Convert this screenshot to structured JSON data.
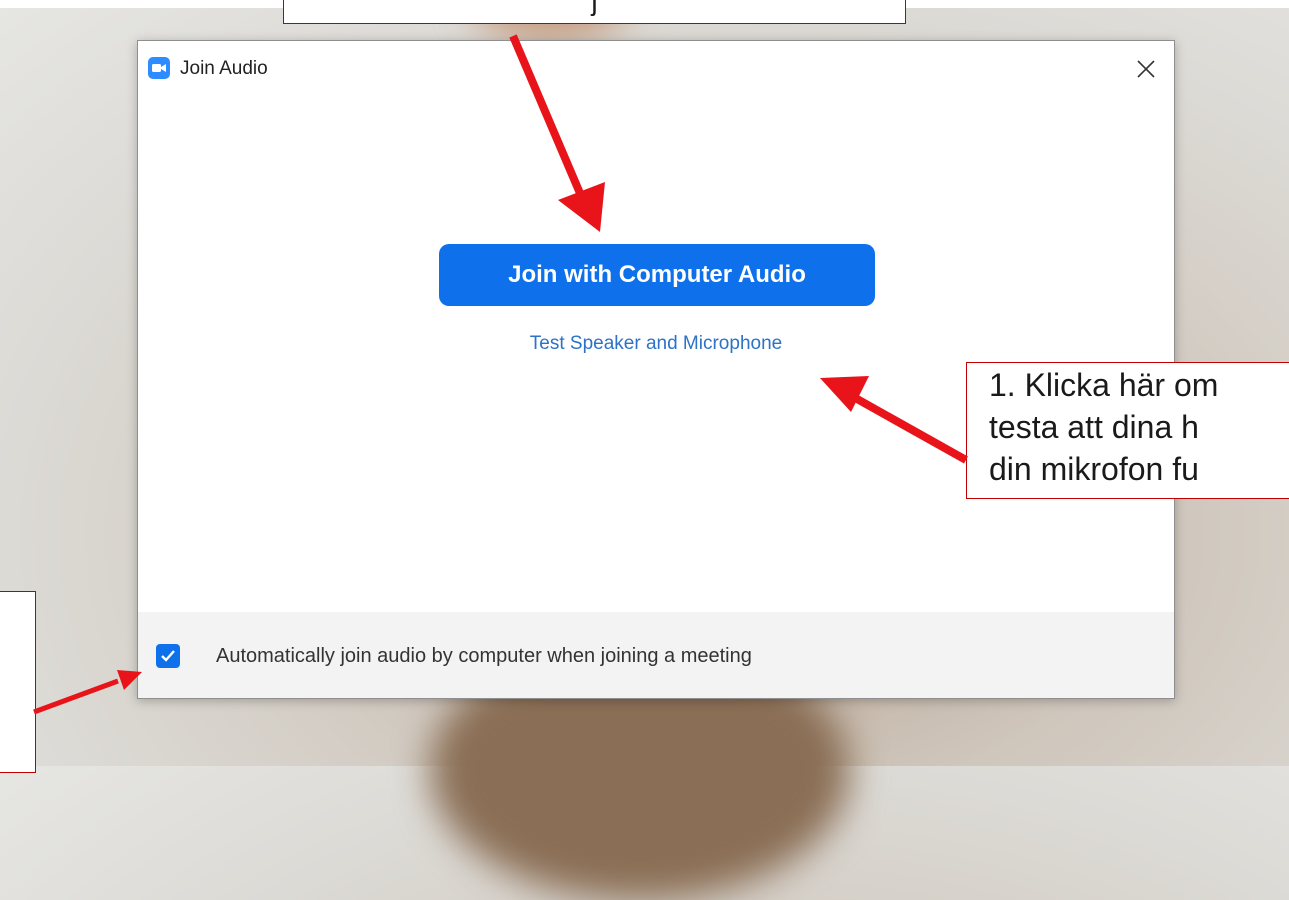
{
  "dialog": {
    "title": "Join Audio",
    "primary_button": "Join with Computer Audio",
    "secondary_link": "Test Speaker and Microphone",
    "auto_join_label": "Automatically join audio by computer when joining a meeting",
    "auto_join_checked": true
  },
  "annotations": {
    "top_text": "j",
    "right_lines": [
      "1. Klicka här om",
      "testa att dina h",
      "din mikrofon fu"
    ]
  },
  "colors": {
    "accent": "#0e71eb",
    "link": "#2d72c6",
    "annotation_red": "#e8141a"
  }
}
